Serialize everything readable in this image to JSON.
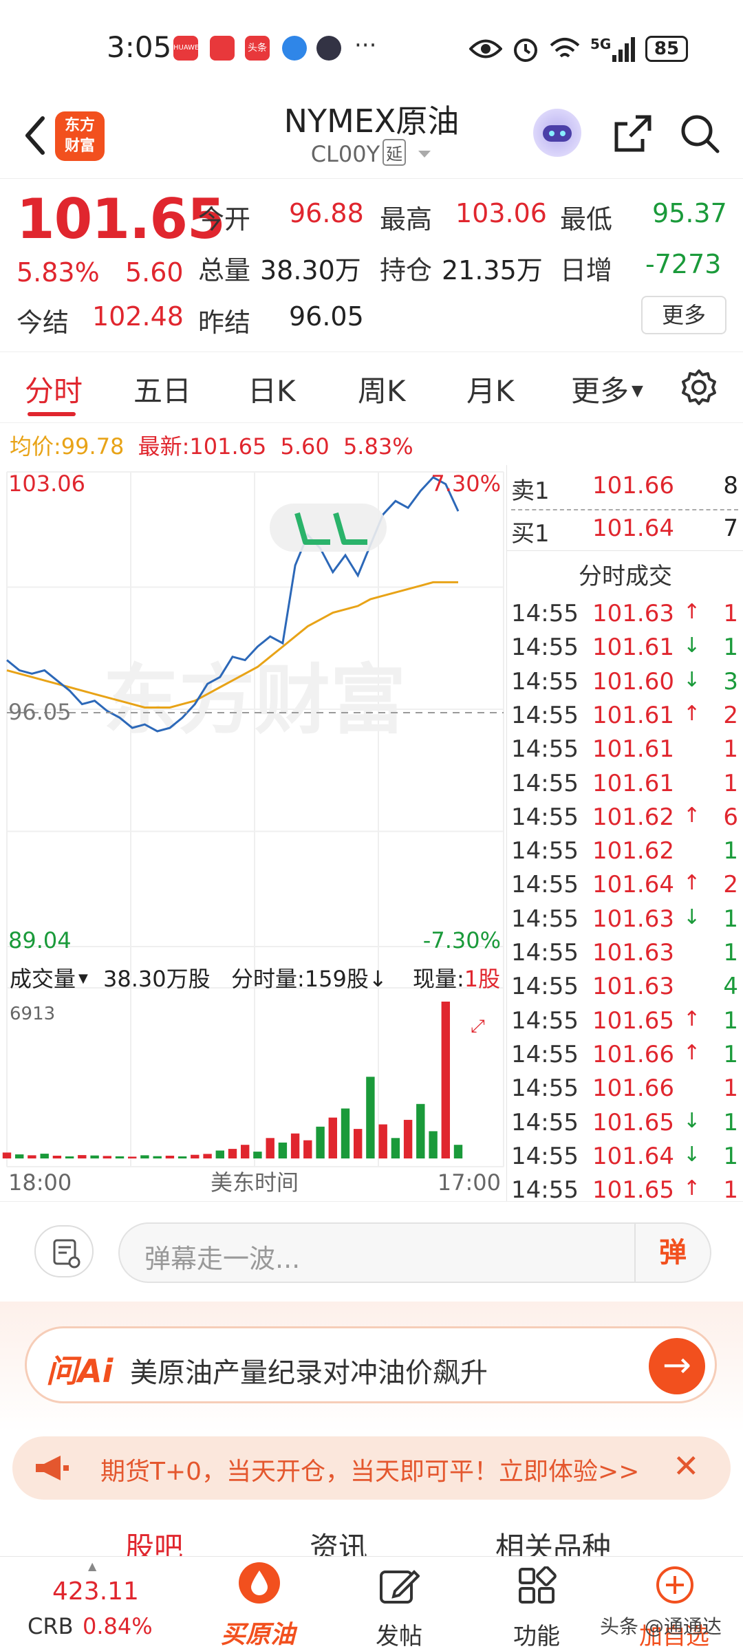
{
  "status_bar": {
    "time": "3:05",
    "apps": [
      "HUAWEI",
      "book-app",
      "头条",
      "browser",
      "avatar"
    ],
    "more": "···",
    "network": "5G",
    "battery": "85"
  },
  "header": {
    "title": "NYMEX原油",
    "subtitle": "CL00Y",
    "delay_badge": "延",
    "logo_text": [
      "东方",
      "财富"
    ]
  },
  "quote": {
    "price": "101.65",
    "change_pct": "5.83%",
    "change": "5.60",
    "settle_today_label": "今结",
    "settle_today": "102.48",
    "settle_prev_label": "昨结",
    "settle_prev": "96.05",
    "open_label": "今开",
    "open": "96.88",
    "high_label": "最高",
    "high": "103.06",
    "low_label": "最低",
    "low": "95.37",
    "volume_label": "总量",
    "volume": "38.30万",
    "oi_label": "持仓",
    "oi": "21.35万",
    "daily_inc_label": "日增",
    "daily_inc": "-7273",
    "more_btn": "更多"
  },
  "tabs": [
    "分时",
    "五日",
    "日K",
    "周K",
    "月K",
    "更多"
  ],
  "avg_bar": {
    "avg_label": "均价:",
    "avg": "99.78",
    "latest_label": "最新:",
    "latest": "101.65",
    "change": "5.60",
    "pct": "5.83%"
  },
  "chart_labels": {
    "y_top": "103.06",
    "y_mid": "96.05",
    "y_bottom": "89.04",
    "pct_top": "7.30%",
    "pct_bottom": "-7.30%",
    "watermark": "东方财富",
    "vol_selector": "成交量",
    "vol_total": "38.30万股",
    "vol_minute": "分时量:159股↓",
    "vol_now_label": "现量:",
    "vol_now": "1股",
    "vol_max": "6913",
    "x_start": "18:00",
    "x_mid": "美东时间",
    "x_end": "17:00"
  },
  "chart_data": {
    "type": "line",
    "title": "",
    "ylim": [
      89.04,
      103.06
    ],
    "series": [
      {
        "values": [
          97.5,
          97.2,
          97.1,
          97.2,
          96.9,
          96.6,
          96.2,
          96.3,
          96.0,
          95.8,
          95.5,
          95.6,
          95.4,
          95.5,
          95.8,
          96.2,
          96.8,
          97.0,
          97.6,
          97.5,
          97.9,
          98.2,
          98.0,
          100.3,
          101.2,
          100.8,
          100.1,
          100.6,
          100.0,
          100.9,
          101.8,
          102.2,
          102.0,
          102.5,
          102.9,
          102.7,
          101.9
        ],
        "color": "#2c68b8"
      },
      {
        "values": [
          97.2,
          97.1,
          97.0,
          96.9,
          96.8,
          96.7,
          96.6,
          96.5,
          96.4,
          96.3,
          96.2,
          96.1,
          96.1,
          96.1,
          96.2,
          96.3,
          96.5,
          96.7,
          96.9,
          97.1,
          97.3,
          97.6,
          97.9,
          98.2,
          98.5,
          98.7,
          98.9,
          99.0,
          99.1,
          99.3,
          99.4,
          99.5,
          99.6,
          99.7,
          99.8,
          99.8,
          99.8
        ],
        "color": "#e8a317"
      }
    ],
    "volume": [
      260,
      180,
      140,
      210,
      120,
      90,
      150,
      130,
      110,
      95,
      80,
      140,
      100,
      120,
      90,
      160,
      200,
      350,
      420,
      600,
      300,
      900,
      700,
      1100,
      800,
      1400,
      1800,
      2200,
      1300,
      3600,
      1500,
      900,
      1700,
      2400,
      1200,
      6913,
      600
    ],
    "volume_colors": [
      "r",
      "g",
      "r",
      "g",
      "r",
      "g",
      "r",
      "g",
      "r",
      "g",
      "r",
      "g",
      "g",
      "r",
      "g",
      "r",
      "r",
      "g",
      "r",
      "r",
      "g",
      "r",
      "g",
      "r",
      "r",
      "g",
      "r",
      "g",
      "r",
      "g",
      "r",
      "g",
      "r",
      "g",
      "g",
      "r",
      "g"
    ]
  },
  "order_book": {
    "sell1_label": "卖1",
    "sell1_price": "101.66",
    "sell1_qty": "8",
    "buy1_label": "买1",
    "buy1_price": "101.64",
    "buy1_qty": "7",
    "ticks_title": "分时成交"
  },
  "ticks": [
    {
      "time": "14:55",
      "price": "101.63",
      "arrow": "↑",
      "qty": "1",
      "qty_color": "red"
    },
    {
      "time": "14:55",
      "price": "101.61",
      "arrow": "↓",
      "qty": "1",
      "qty_color": "green"
    },
    {
      "time": "14:55",
      "price": "101.60",
      "arrow": "↓",
      "qty": "3",
      "qty_color": "green"
    },
    {
      "time": "14:55",
      "price": "101.61",
      "arrow": "↑",
      "qty": "2",
      "qty_color": "red"
    },
    {
      "time": "14:55",
      "price": "101.61",
      "arrow": "",
      "qty": "1",
      "qty_color": "red"
    },
    {
      "time": "14:55",
      "price": "101.61",
      "arrow": "",
      "qty": "1",
      "qty_color": "red"
    },
    {
      "time": "14:55",
      "price": "101.62",
      "arrow": "↑",
      "qty": "6",
      "qty_color": "red"
    },
    {
      "time": "14:55",
      "price": "101.62",
      "arrow": "",
      "qty": "1",
      "qty_color": "green"
    },
    {
      "time": "14:55",
      "price": "101.64",
      "arrow": "↑",
      "qty": "2",
      "qty_color": "red"
    },
    {
      "time": "14:55",
      "price": "101.63",
      "arrow": "↓",
      "qty": "1",
      "qty_color": "green"
    },
    {
      "time": "14:55",
      "price": "101.63",
      "arrow": "",
      "qty": "1",
      "qty_color": "green"
    },
    {
      "time": "14:55",
      "price": "101.63",
      "arrow": "",
      "qty": "4",
      "qty_color": "green"
    },
    {
      "time": "14:55",
      "price": "101.65",
      "arrow": "↑",
      "qty": "1",
      "qty_color": "green"
    },
    {
      "time": "14:55",
      "price": "101.66",
      "arrow": "↑",
      "qty": "1",
      "qty_color": "green"
    },
    {
      "time": "14:55",
      "price": "101.66",
      "arrow": "",
      "qty": "1",
      "qty_color": "red"
    },
    {
      "time": "14:55",
      "price": "101.65",
      "arrow": "↓",
      "qty": "1",
      "qty_color": "green"
    },
    {
      "time": "14:55",
      "price": "101.64",
      "arrow": "↓",
      "qty": "1",
      "qty_color": "green"
    },
    {
      "time": "14:55",
      "price": "101.65",
      "arrow": "↑",
      "qty": "1",
      "qty_color": "red"
    }
  ],
  "danmu": {
    "placeholder": "弹幕走一波...",
    "send_label": "弹"
  },
  "ask_ai": {
    "logo": "问Ai",
    "text": "美原油产量纪录对冲油价飙升",
    "go": "→"
  },
  "promo": {
    "text": "期货T+0，当天开仓，当天即可平！立即体验>>",
    "close": "✕"
  },
  "sub_tabs": [
    "股吧",
    "资讯",
    "相关品种"
  ],
  "bottom_bar": {
    "crb_value": "423.11",
    "crb_label": "CRB",
    "crb_pct": "0.84%",
    "buy_label": "买原油",
    "post_label": "发帖",
    "func_label": "功能",
    "fav_label": "加自选"
  },
  "watermark": "头条 @通通达",
  "colors": {
    "red": "#e0262e",
    "green": "#1a9a3a",
    "orange": "#f2501e",
    "price_line": "#2c68b8",
    "avg_line": "#e8a317"
  }
}
